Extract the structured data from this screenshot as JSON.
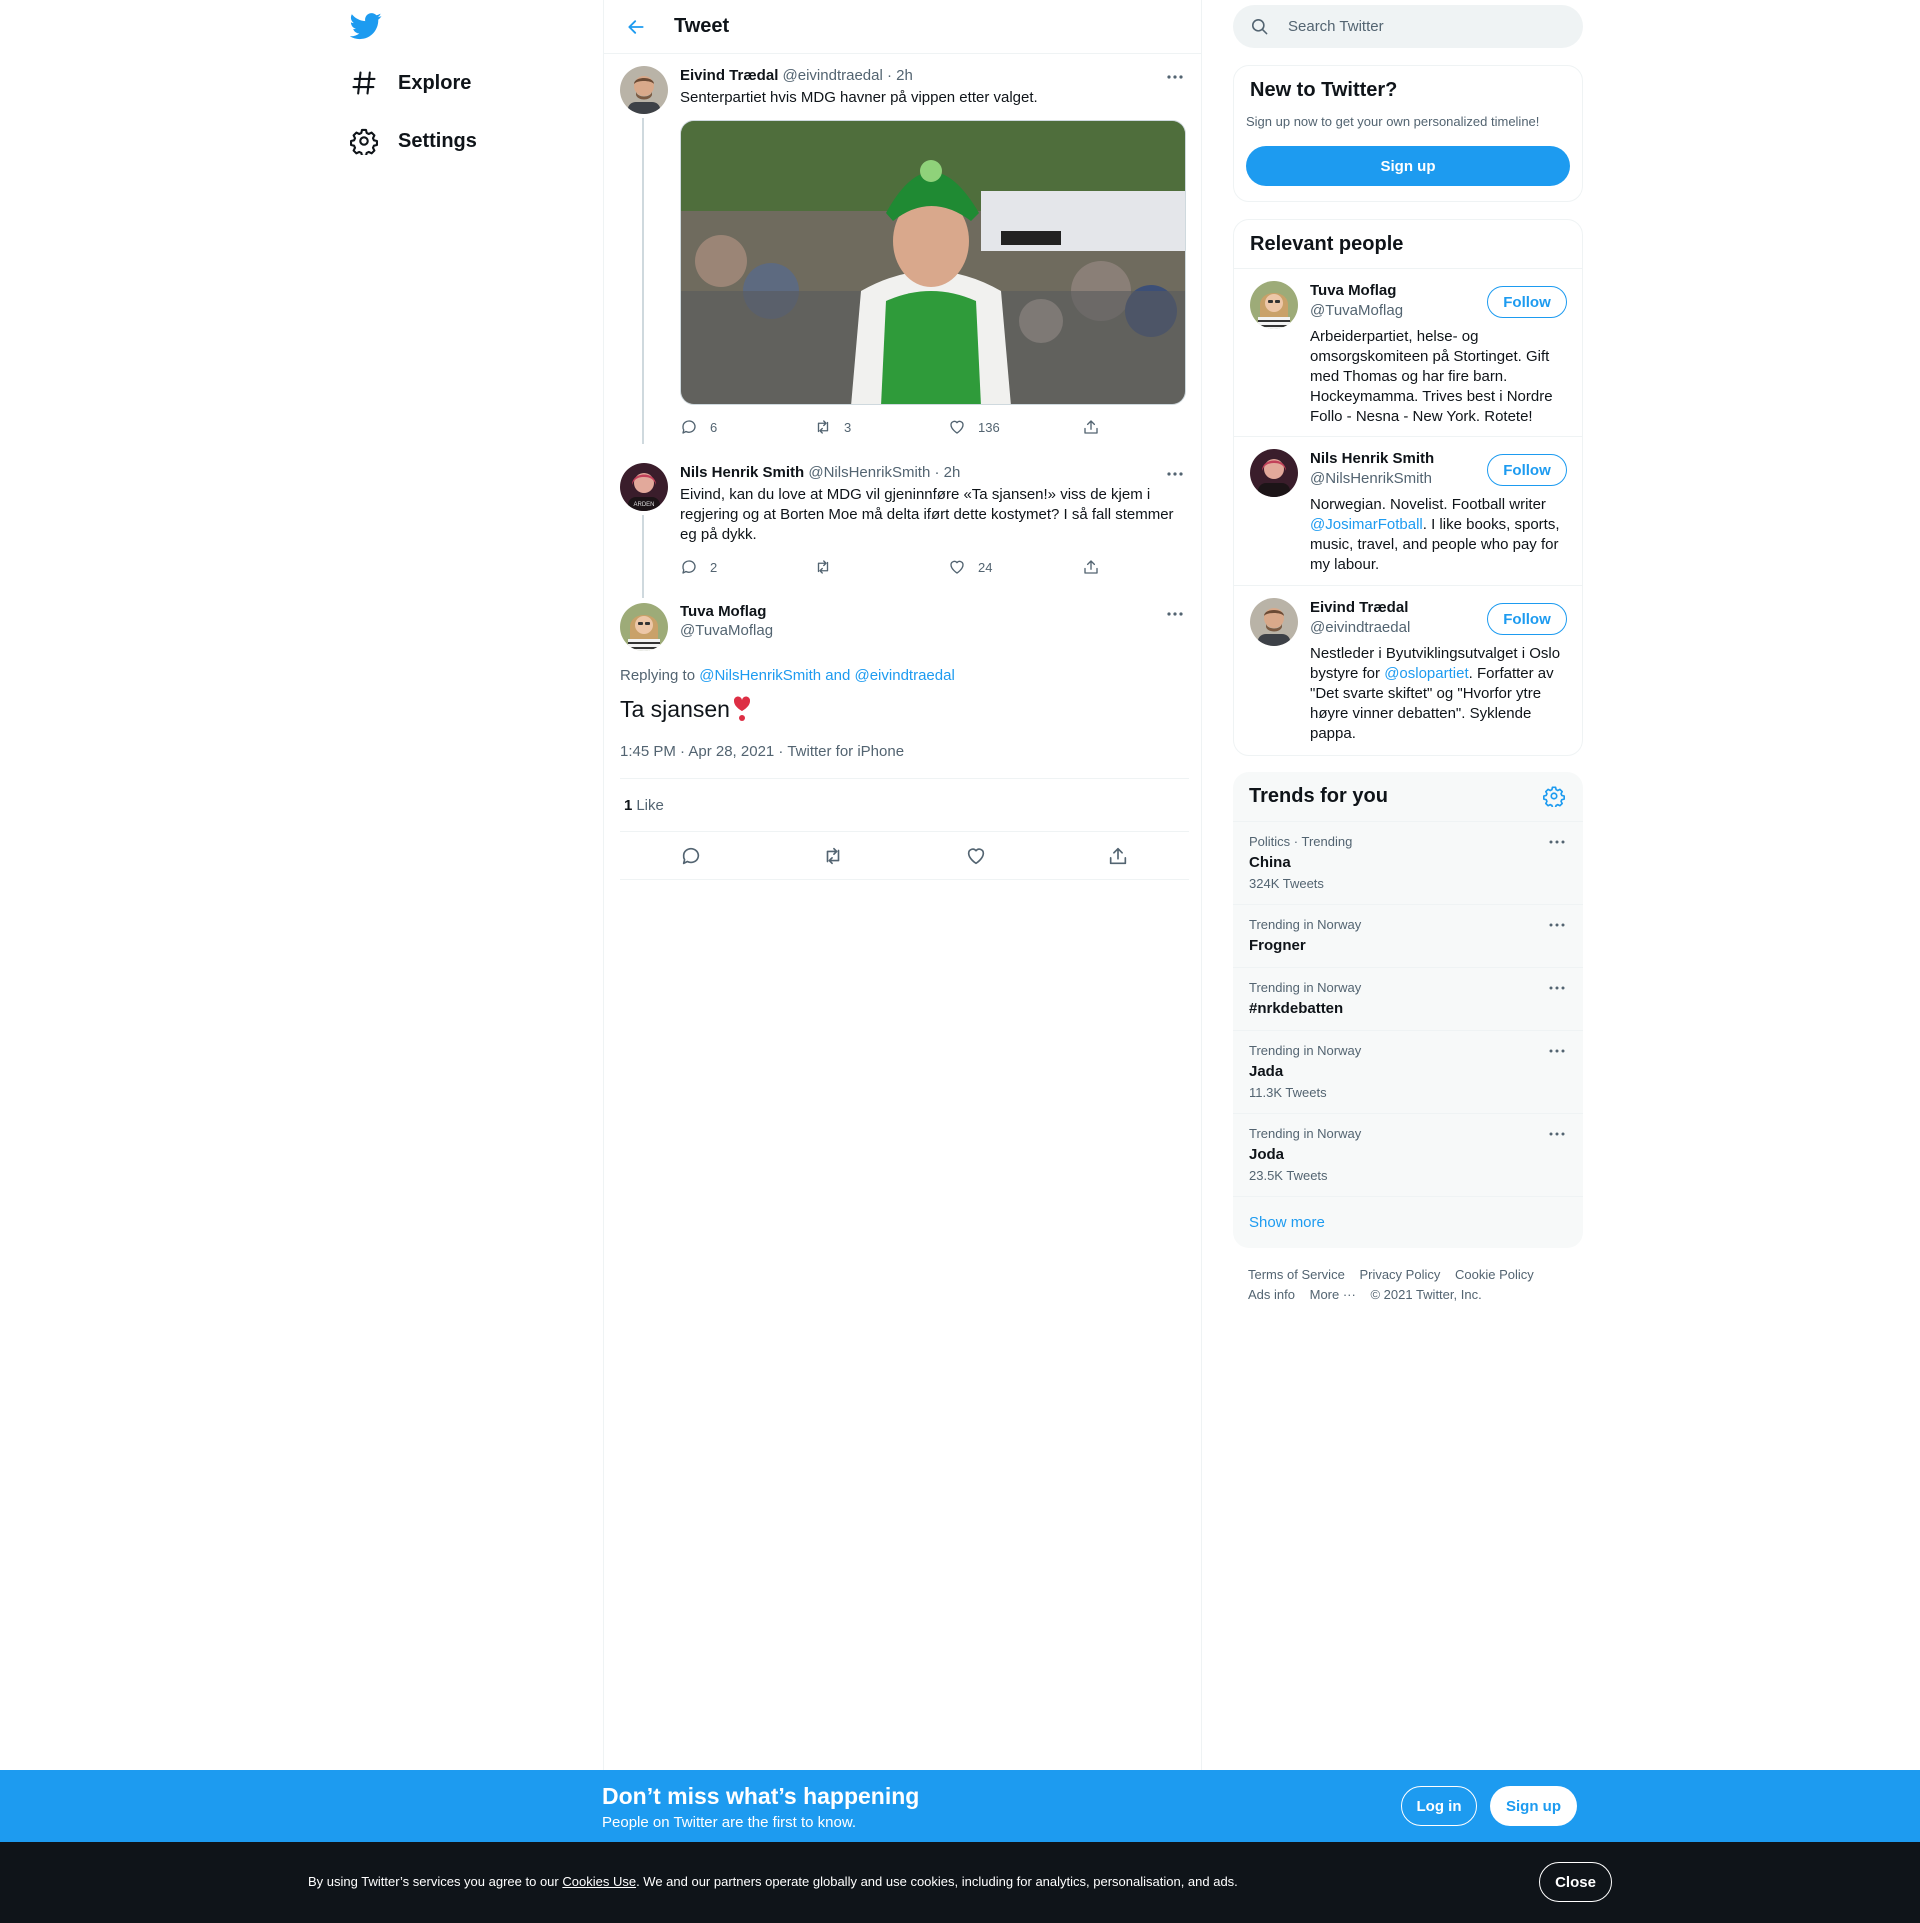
{
  "colors": {
    "brand": "#1d9bf0",
    "text": "#0f1419",
    "secondary": "#536471",
    "border": "#eff3f4",
    "cookie_bg": "#0f1419"
  },
  "nav": {
    "logo_icon": "twitter-bird-icon",
    "items": [
      {
        "label": "Explore",
        "icon": "hashtag-icon"
      },
      {
        "label": "Settings",
        "icon": "gear-icon"
      }
    ]
  },
  "header": {
    "title": "Tweet",
    "back_icon": "arrow-left-icon"
  },
  "thread": [
    {
      "name": "Eivind Trædal",
      "handle": "@eivindtraedal",
      "time": "2h",
      "text": "Senterpartiet hvis MDG havner på vippen etter valget.",
      "has_media": true,
      "media_description": "green-helmet-cyclist-photo",
      "replies": "6",
      "retweets": "3",
      "likes": "136"
    },
    {
      "name": "Nils Henrik Smith",
      "handle": "@NilsHenrikSmith",
      "time": "2h",
      "text": "Eivind, kan du love at MDG vil gjeninnføre «Ta sjansen!» viss de kjem i regjering og at Borten Moe må delta iført dette kostymet? I så fall stemmer eg på dykk.",
      "replies": "2",
      "retweets": "",
      "likes": "24"
    }
  ],
  "focal": {
    "name": "Tuva Moflag",
    "handle": "@TuvaMoflag",
    "replying_label": "Replying to",
    "replying_to": "@NilsHenrikSmith and @eivindtraedal",
    "text": "Ta sjansen",
    "emoji": "❣",
    "timestamp": "1:45 PM · Apr 28, 2021 · Twitter for iPhone",
    "like_count": "1",
    "like_label": "Like"
  },
  "search": {
    "placeholder": "Search Twitter"
  },
  "signup_card": {
    "title": "New to Twitter?",
    "subtitle": "Sign up now to get your own personalized timeline!",
    "button": "Sign up"
  },
  "relevant": {
    "title": "Relevant people",
    "follow_label": "Follow",
    "people": [
      {
        "name": "Tuva Moflag",
        "handle": "@TuvaMoflag",
        "bio": "Arbeiderpartiet, helse- og omsorgskomiteen på Stortinget. Gift med Thomas og har fire barn. Hockeymamma. Trives best i Nordre Follo - Nesna - New York. Rotete!"
      },
      {
        "name": "Nils Henrik Smith",
        "handle": "@NilsHenrikSmith",
        "bio_before": "Norwegian. Novelist. Football writer ",
        "bio_link": "@JosimarFotball",
        "bio_after": ". I like books, sports, music, travel, and people who pay for my labour."
      },
      {
        "name": "Eivind Trædal",
        "handle": "@eivindtraedal",
        "bio_before": "Nestleder i Byutviklingsutvalget i Oslo bystyre for ",
        "bio_link": "@oslopartiet",
        "bio_after": ". Forfatter av \"Det svarte skiftet\" og \"Hvorfor ytre høyre vinner debatten\". Syklende pappa."
      }
    ]
  },
  "trends": {
    "title": "Trends for you",
    "items": [
      {
        "context": "Politics · Trending",
        "name": "China",
        "count": "324K Tweets"
      },
      {
        "context": "Trending in Norway",
        "name": "Frogner",
        "count": ""
      },
      {
        "context": "Trending in Norway",
        "name": "#nrkdebatten",
        "count": ""
      },
      {
        "context": "Trending in Norway",
        "name": "Jada",
        "count": "11.3K Tweets"
      },
      {
        "context": "Trending in Norway",
        "name": "Joda",
        "count": "23.5K Tweets"
      }
    ],
    "show_more": "Show more"
  },
  "footer": {
    "links": [
      "Terms of Service",
      "Privacy Policy",
      "Cookie Policy",
      "Ads info",
      "More ···",
      "© 2021 Twitter, Inc."
    ]
  },
  "promo": {
    "title": "Don’t miss what’s happening",
    "subtitle": "People on Twitter are the first to know.",
    "login": "Log in",
    "signup": "Sign up"
  },
  "cookie": {
    "before": "By using Twitter’s services you agree to our ",
    "link": "Cookies Use",
    "after": ". We and our partners operate globally and use cookies, including for analytics, personalisation, and ads.",
    "close": "Close"
  }
}
